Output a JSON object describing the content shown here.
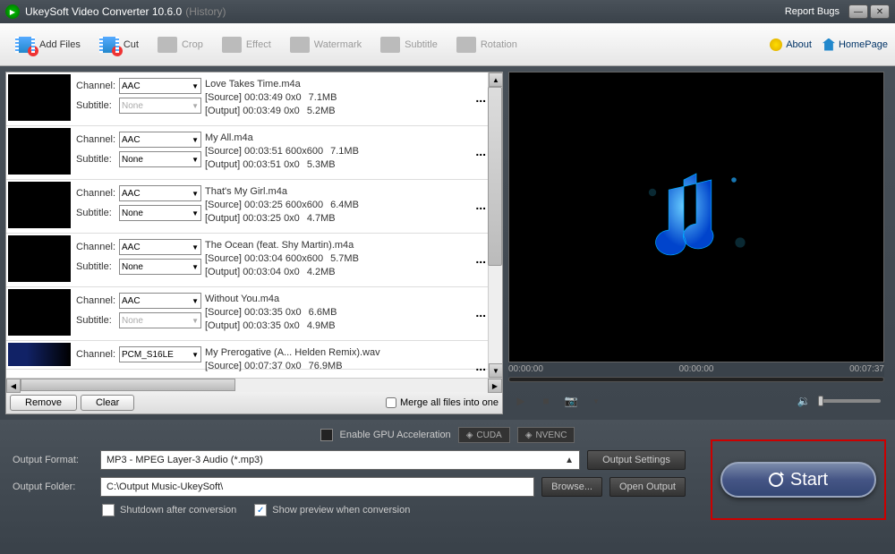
{
  "window": {
    "title_main": "UkeySoft Video Converter 10.6.0",
    "title_sub": "(History)",
    "report": "Report Bugs"
  },
  "toolbar": {
    "add_files": "Add Files",
    "cut": "Cut",
    "crop": "Crop",
    "effect": "Effect",
    "watermark": "Watermark",
    "subtitle": "Subtitle",
    "rotation": "Rotation",
    "about": "About",
    "homepage": "HomePage"
  },
  "labels": {
    "channel": "Channel:",
    "subtitle": "Subtitle:",
    "none": "None",
    "remove": "Remove",
    "clear": "Clear",
    "merge": "Merge all files into one"
  },
  "files": [
    {
      "channel": "AAC",
      "subtitle": "None",
      "subtitle_disabled": true,
      "name": "Love Takes Time.m4a",
      "source": "[Source]  00:03:49  0x0",
      "output": "[Output]  00:03:49  0x0",
      "ssize": "7.1MB",
      "osize": "5.2MB"
    },
    {
      "channel": "AAC",
      "subtitle": "None",
      "subtitle_disabled": false,
      "name": "My All.m4a",
      "source": "[Source]  00:03:51  600x600",
      "output": "[Output]  00:03:51  0x0",
      "ssize": "7.1MB",
      "osize": "5.3MB"
    },
    {
      "channel": "AAC",
      "subtitle": "None",
      "subtitle_disabled": false,
      "name": "That's My Girl.m4a",
      "source": "[Source]  00:03:25  600x600",
      "output": "[Output]  00:03:25  0x0",
      "ssize": "6.4MB",
      "osize": "4.7MB"
    },
    {
      "channel": "AAC",
      "subtitle": "None",
      "subtitle_disabled": false,
      "name": "The Ocean (feat. Shy Martin).m4a",
      "source": "[Source]  00:03:04  600x600",
      "output": "[Output]  00:03:04  0x0",
      "ssize": "5.7MB",
      "osize": "4.2MB"
    },
    {
      "channel": "AAC",
      "subtitle": "None",
      "subtitle_disabled": true,
      "name": "Without You.m4a",
      "source": "[Source]  00:03:35  0x0",
      "output": "[Output]  00:03:35  0x0",
      "ssize": "6.6MB",
      "osize": "4.9MB"
    }
  ],
  "partial_file": {
    "channel": "PCM_S16LE",
    "name": "My Prerogative (A... Helden Remix).wav",
    "source": "[Source]  00:07:37  0x0",
    "ssize": "76.9MB"
  },
  "preview": {
    "t0": "00:00:00",
    "t1": "00:00:00",
    "t2": "00:07:37"
  },
  "footer": {
    "gpu_label": "Enable GPU Acceleration",
    "cuda": "CUDA",
    "nvenc": "NVENC",
    "output_format_label": "Output Format:",
    "output_format_value": "MP3 - MPEG Layer-3 Audio (*.mp3)",
    "output_folder_label": "Output Folder:",
    "output_folder_value": "C:\\Output Music-UkeySoft\\",
    "output_settings": "Output Settings",
    "browse": "Browse...",
    "open_output": "Open Output",
    "shutdown": "Shutdown after conversion",
    "preview": "Show preview when conversion",
    "start": "Start"
  }
}
